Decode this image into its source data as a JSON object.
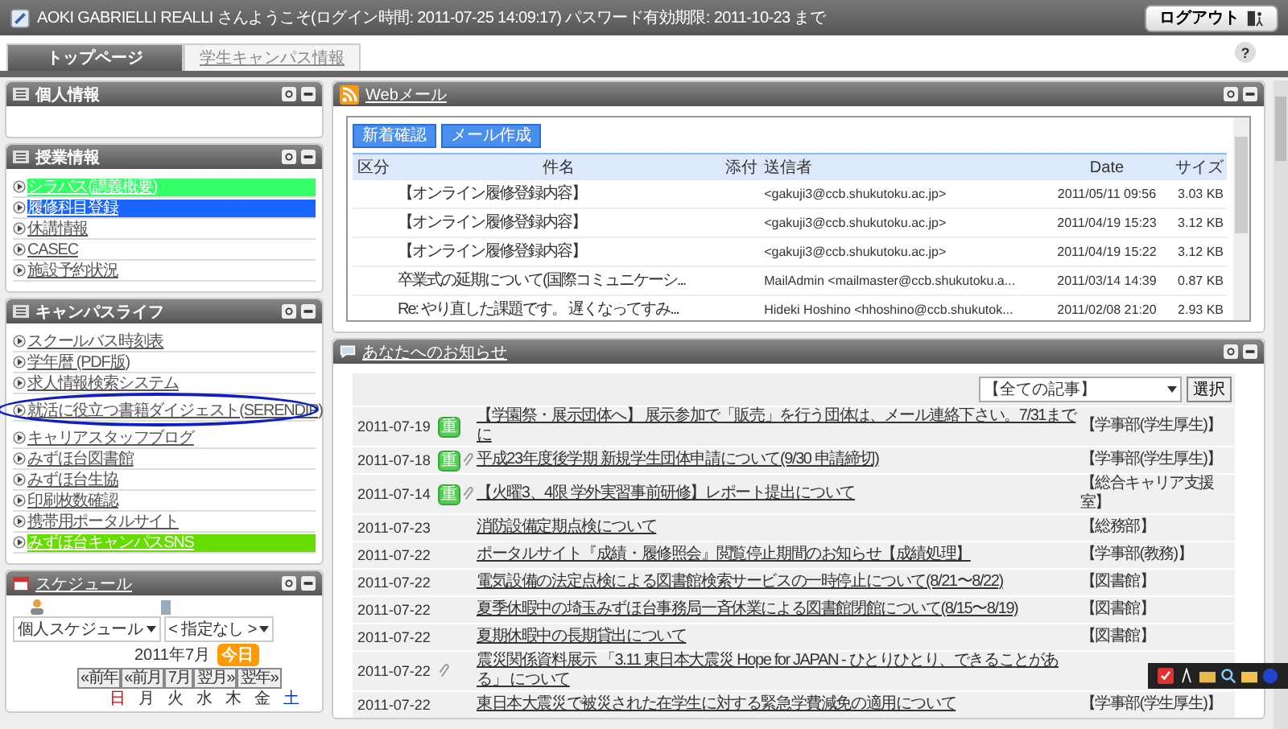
{
  "header": {
    "welcome": "AOKI GABRIELLI REALLI さんようこそ(ログイン時間: 2011-07-25 14:09:17) パスワード有効期限: 2011-10-23 まで",
    "logout": "ログアウト"
  },
  "tabs": [
    {
      "label": "トップページ",
      "selected": true
    },
    {
      "label": "学生キャンパス情報",
      "selected": false
    }
  ],
  "help": "?",
  "sidebar": [
    {
      "title": "個人情報"
    },
    {
      "title": "授業情報",
      "items": [
        {
          "label": "シラバス(講義概要)",
          "color": "#33ff66",
          "circled": false
        },
        {
          "label": "履修科目登録",
          "color": "#1a66ff",
          "circled": false
        },
        {
          "label": "休講情報",
          "circled": false
        },
        {
          "label": "CASEC",
          "circled": false
        },
        {
          "label": "施設予約状況",
          "circled": false
        }
      ]
    },
    {
      "title": "キャンパスライフ",
      "items": [
        {
          "label": "スクールバス時刻表",
          "circled": false
        },
        {
          "label": "学年暦 (PDF版)",
          "circled": false
        },
        {
          "label": "求人情報検索システム",
          "circled": false
        },
        {
          "label": "就活に役立つ書籍ダイジェスト(SERENDIP)",
          "circled": true
        },
        {
          "label": "キャリアスタッフブログ",
          "circled": false
        },
        {
          "label": "みずほ台図書館",
          "circled": false
        },
        {
          "label": "みずほ台生協",
          "circled": false
        },
        {
          "label": "印刷枚数確認",
          "circled": false
        },
        {
          "label": "携帯用ポータルサイト",
          "circled": false
        },
        {
          "label": "みずほ台キャンパスSNS",
          "color": "#66dd00",
          "circled": false
        }
      ]
    }
  ],
  "schedule": {
    "title": "スケジュール",
    "personal": "個人スケジュール",
    "target": "< 指定なし >",
    "month": "2011年7月",
    "today": "今日",
    "nav": [
      "«前年",
      "«前月",
      "7月",
      "翌月»",
      "翌年»"
    ],
    "weekdays": [
      "日",
      "月",
      "火",
      "水",
      "木",
      "金",
      "土"
    ]
  },
  "webmail": {
    "title": "Webメール",
    "buttons": [
      "新着確認",
      "メール作成"
    ],
    "columns": [
      "区分",
      "件名",
      "添付",
      "送信者",
      "Date",
      "サイズ"
    ],
    "rows": [
      [
        "",
        "【オンライン履修登録内容】",
        "",
        "<gakuji3@ccb.shukutoku.ac.jp>",
        "2011/05/11 09:56",
        "3.03 KB"
      ],
      [
        "",
        "【オンライン履修登録内容】",
        "",
        "<gakuji3@ccb.shukutoku.ac.jp>",
        "2011/04/19 15:23",
        "3.12 KB"
      ],
      [
        "",
        "【オンライン履修登録内容】",
        "",
        "<gakuji3@ccb.shukutoku.ac.jp>",
        "2011/04/19 15:22",
        "3.12 KB"
      ],
      [
        "",
        "卒業式の延期について(国際コミュニケーシ...",
        "",
        "MailAdmin <mailmaster@ccb.shukutoku.a...",
        "2011/03/14 14:39",
        "0.87 KB"
      ],
      [
        "",
        "Re: やり直した課題です。 遅くなってすみ...",
        "",
        "Hideki Hoshino <hhoshino@ccb.shukutok...",
        "2011/02/08 21:20",
        "2.93 KB"
      ]
    ]
  },
  "notices": {
    "title": "あなたへのお知らせ",
    "filter": "【全ての記事】",
    "select_button": "選択",
    "rows": [
      {
        "date": "2011-07-19",
        "badge": "重",
        "attachment": false,
        "title": "【学園祭・展示団体へ】 展示参加で「販売」を行う団体は、メール連絡下さい。7/31までに",
        "dept": "【学事部(学生厚生)】"
      },
      {
        "date": "2011-07-18",
        "badge": "重",
        "attachment": true,
        "title": "平成23年度後学期 新規学生団体申請について(9/30 申請締切)",
        "dept": "【学事部(学生厚生)】"
      },
      {
        "date": "2011-07-14",
        "badge": "重",
        "attachment": true,
        "title": "【火曜3、4限 学外実習事前研修】レポート提出について",
        "dept": "【総合キャリア支援室】"
      },
      {
        "date": "2011-07-23",
        "attachment": false,
        "title": "消防設備定期点検について",
        "dept": "【総務部】"
      },
      {
        "date": "2011-07-22",
        "attachment": false,
        "title": "ポータルサイト『成績・履修照会』閲覧停止期間のお知らせ【成績処理】",
        "dept": "【学事部(教務)】"
      },
      {
        "date": "2011-07-22",
        "attachment": false,
        "title": "電気設備の法定点検による図書館検索サービスの一時停止について(8/21〜8/22)",
        "dept": "【図書館】"
      },
      {
        "date": "2011-07-22",
        "attachment": false,
        "title": "夏季休暇中の埼玉みずほ台事務局一斉休業による図書館閉館について(8/15〜8/19)",
        "dept": "【図書館】"
      },
      {
        "date": "2011-07-22",
        "attachment": false,
        "title": "夏期休暇中の長期貸出について",
        "dept": "【図書館】"
      },
      {
        "date": "2011-07-22",
        "attachment": true,
        "title": "震災関係資料展示 「3.11 東日本大震災 Hope for JAPAN - ひとりひとり、できることがある」 について"
      },
      {
        "date": "2011-07-22",
        "attachment": false,
        "title": "東日本大震災で被災された在学生に対する緊急学費減免の適用について",
        "dept": "【学事部(学生厚生)】"
      }
    ]
  }
}
